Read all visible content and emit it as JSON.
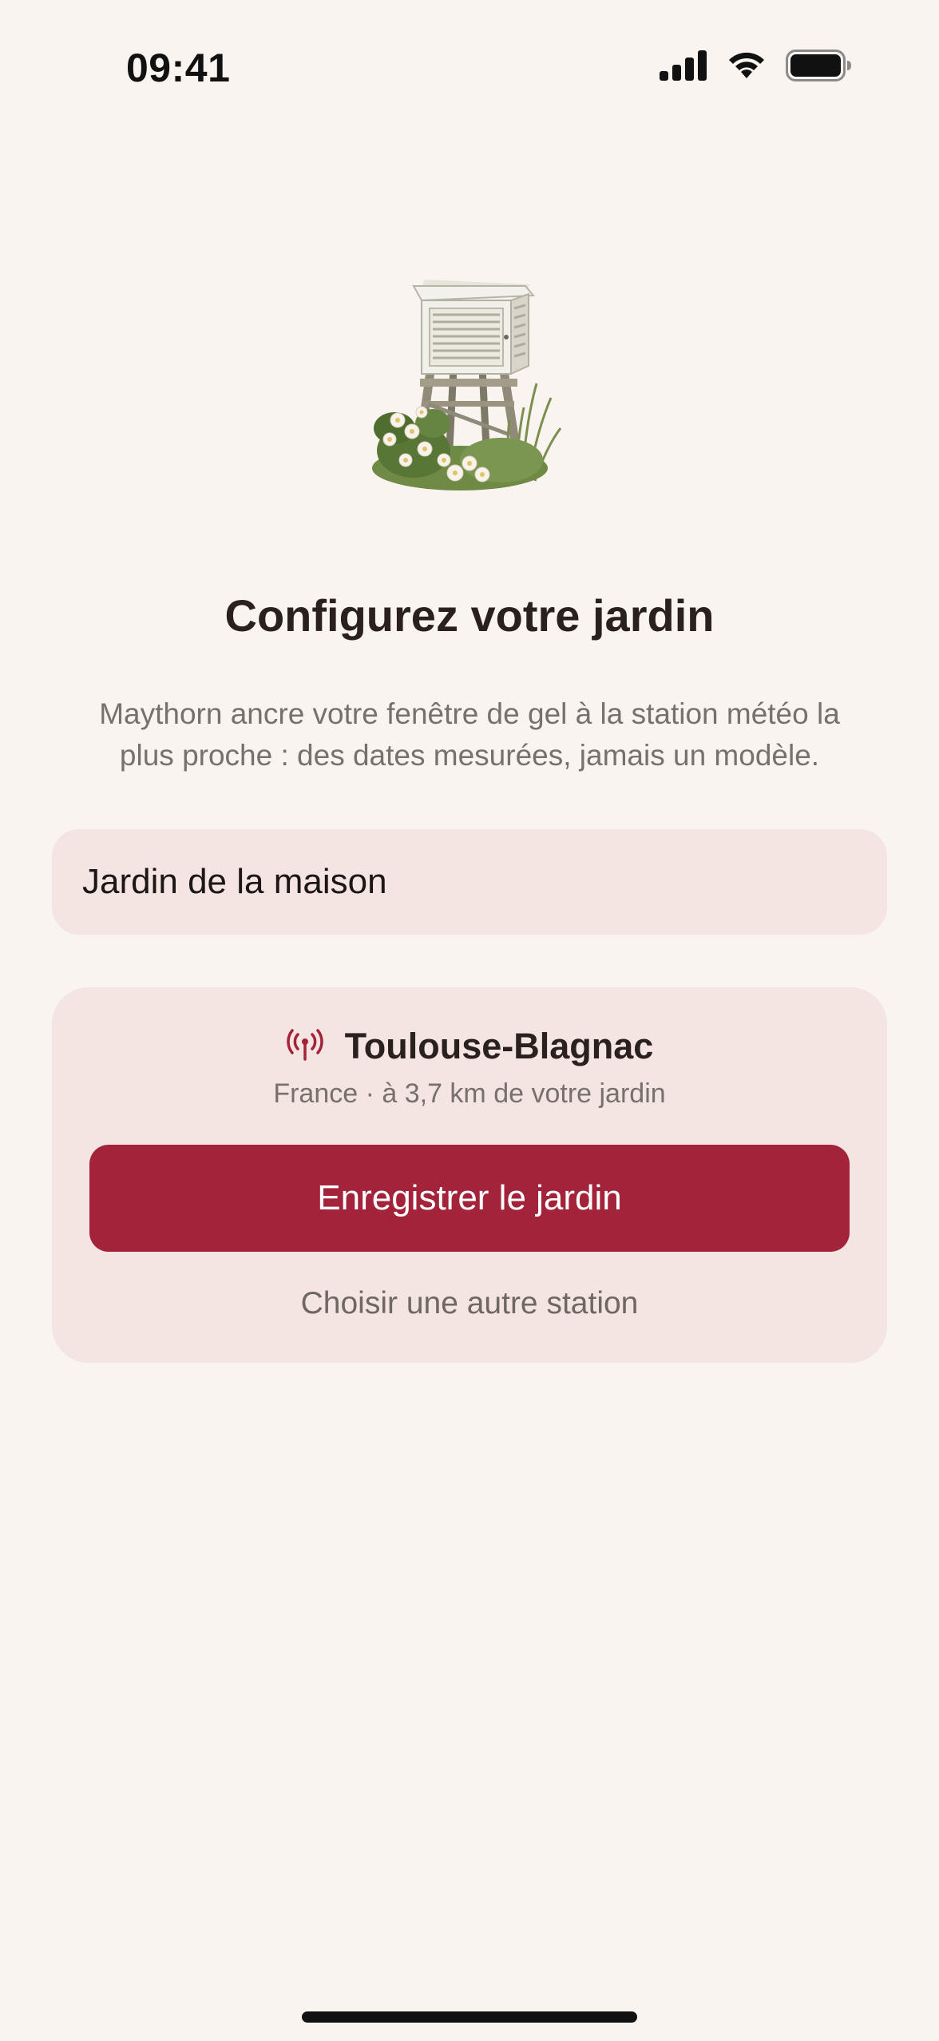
{
  "status_bar": {
    "time": "09:41",
    "icons": [
      "cellular-signal-icon",
      "wifi-icon",
      "battery-icon"
    ]
  },
  "hero": {
    "icon": "weather-station-illustration"
  },
  "page": {
    "title": "Configurez votre jardin",
    "subtitle_line1": "Maythorn ancre votre fenêtre de gel à la station météo la",
    "subtitle_line2": "plus proche : des dates mesurées, jamais un modèle."
  },
  "garden_name": {
    "value": "Jardin de la maison"
  },
  "station": {
    "icon": "antenna-icon",
    "name": "Toulouse-Blagnac",
    "meta": "France · à 3,7 km de votre jardin",
    "save_label": "Enregistrer le jardin",
    "change_label": "Choisir une autre station"
  },
  "colors": {
    "background": "#f9f4ef",
    "card": "#f4e4e2",
    "accent": "#a3233a",
    "text": "#2a211d",
    "muted": "#77706b"
  }
}
